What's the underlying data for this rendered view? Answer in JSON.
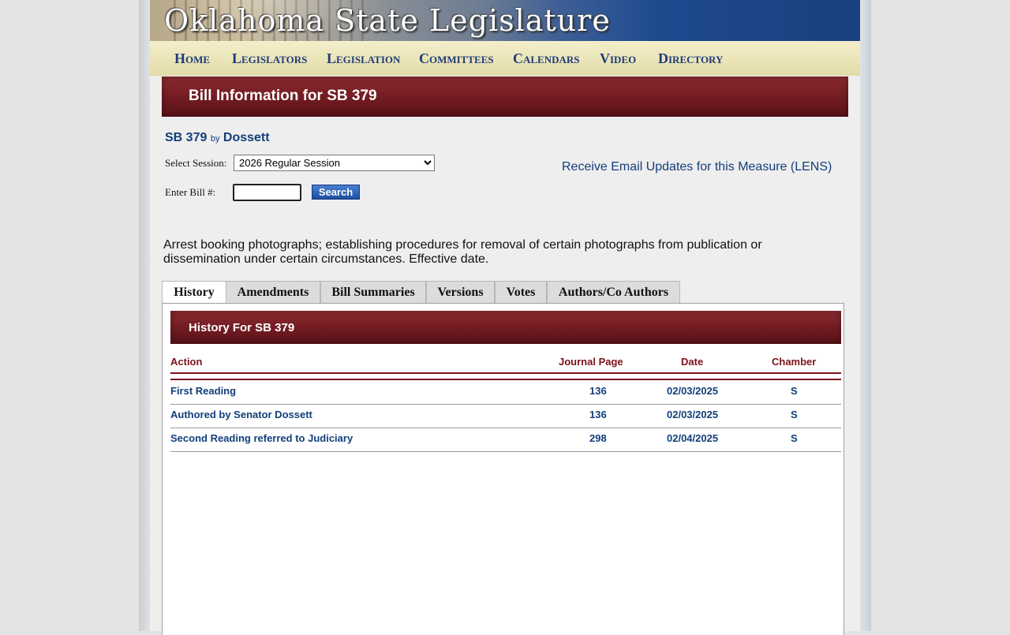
{
  "banner": {
    "title": "Oklahoma State Legislature"
  },
  "nav": [
    "Home",
    "Legislators",
    "Legislation",
    "Committees",
    "Calendars",
    "Video",
    "Directory"
  ],
  "bill_header": "Bill Information for SB 379",
  "bill": {
    "number": "SB 379",
    "by": "by",
    "author": "Dossett"
  },
  "session": {
    "label": "Select Session:",
    "selected": "2026 Regular Session"
  },
  "bill_search": {
    "label": "Enter Bill #:",
    "value": "",
    "button": "Search"
  },
  "lens_link": "Receive Email Updates for this Measure (LENS)",
  "description": "Arrest booking photographs; establishing procedures for removal of certain photographs from publication or dissemination under certain circumstances. Effective date.",
  "tabs": [
    "History",
    "Amendments",
    "Bill Summaries",
    "Versions",
    "Votes",
    "Authors/Co Authors"
  ],
  "active_tab": "History",
  "history": {
    "title": "History For SB 379",
    "columns": [
      "Action",
      "Journal Page",
      "Date",
      "Chamber"
    ],
    "rows": [
      {
        "action": "First Reading",
        "journal_page": "136",
        "date": "02/03/2025",
        "chamber": "S"
      },
      {
        "action": "Authored by Senator Dossett",
        "journal_page": "136",
        "date": "02/03/2025",
        "chamber": "S"
      },
      {
        "action": "Second Reading referred to Judiciary",
        "journal_page": "298",
        "date": "02/04/2025",
        "chamber": "S"
      }
    ]
  },
  "colors": {
    "maroon": "#7a1218",
    "link_blue": "#123f7a",
    "nav_bg": "#ebe5b9"
  }
}
